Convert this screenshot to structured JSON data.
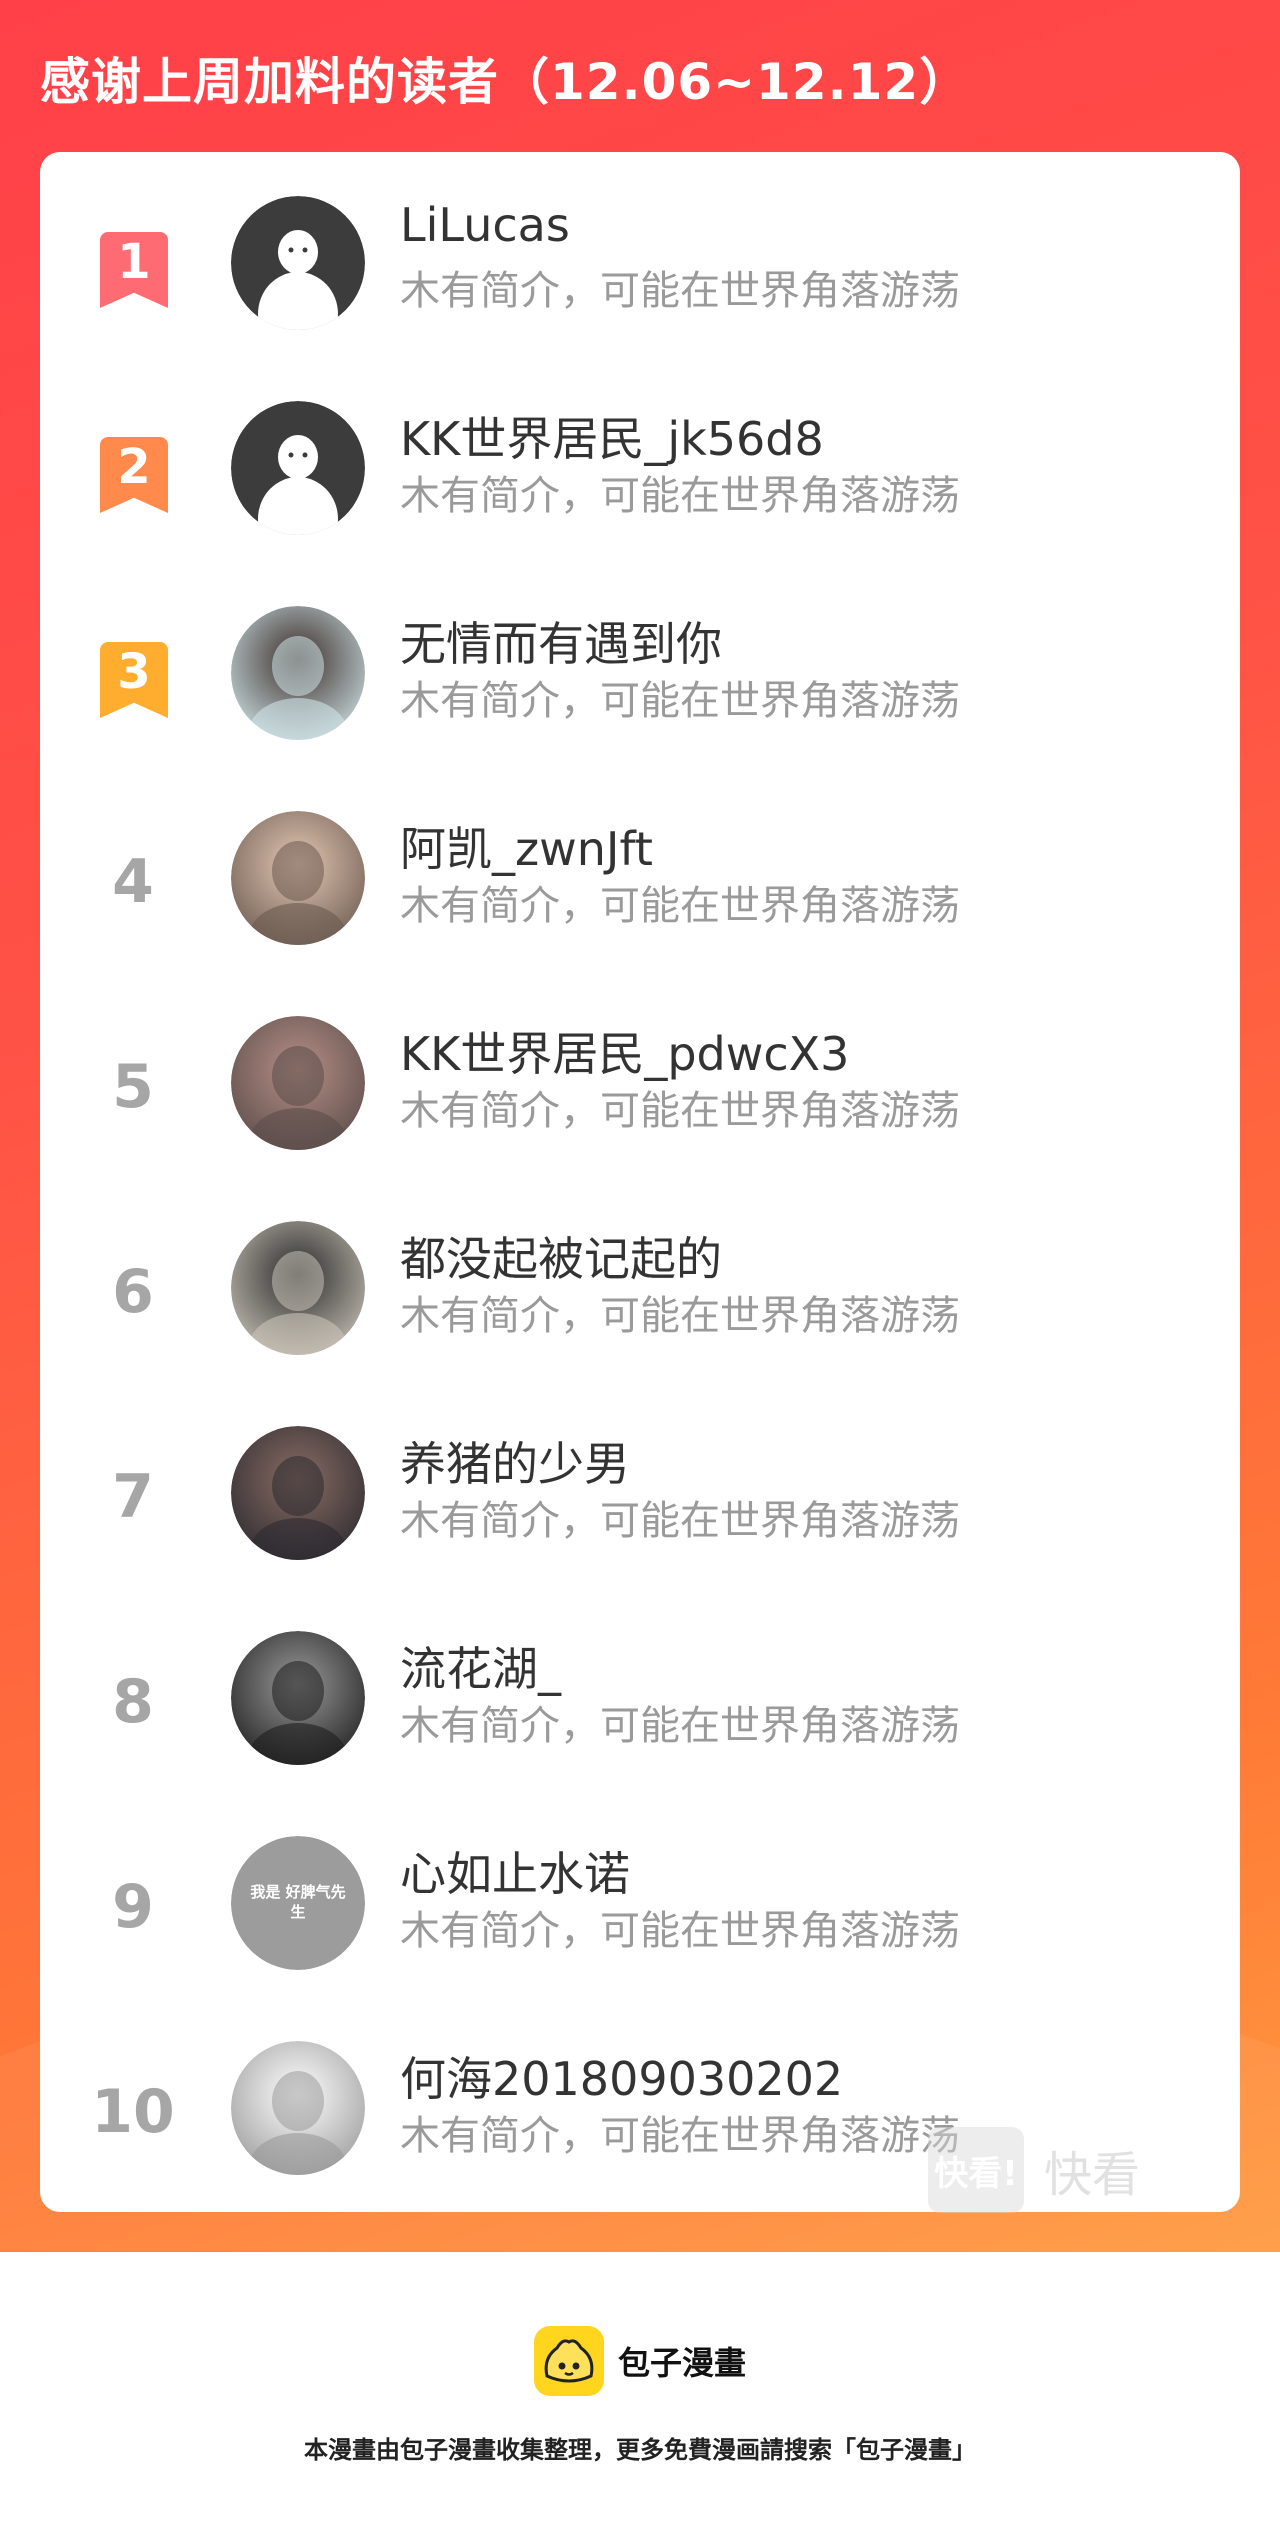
{
  "header": {
    "title": "感谢上周加料的读者（12.06~12.12）"
  },
  "readers": [
    {
      "rank": "1",
      "name": "LiLucas",
      "bio": "木有简介，可能在世界角落游荡",
      "badge_color": "#ff6b72",
      "avatar": "default-avatar"
    },
    {
      "rank": "2",
      "name": "KK世界居民_jk56d8",
      "bio": "木有简介，可能在世界角落游荡",
      "badge_color": "#ff8a4c",
      "avatar": "default-avatar"
    },
    {
      "rank": "3",
      "name": "无情而有遇到你",
      "bio": "木有简介，可能在世界角落游荡",
      "badge_color": "#ffad2e",
      "avatar": "photo-avatar"
    },
    {
      "rank": "4",
      "name": "阿凯_zwnJft",
      "bio": "木有简介，可能在世界角落游荡",
      "avatar": "photo-avatar"
    },
    {
      "rank": "5",
      "name": "KK世界居民_pdwcX3",
      "bio": "木有简介，可能在世界角落游荡",
      "avatar": "photo-avatar"
    },
    {
      "rank": "6",
      "name": "都没起被记起的",
      "bio": "木有简介，可能在世界角落游荡",
      "avatar": "photo-avatar"
    },
    {
      "rank": "7",
      "name": "养猪的少男",
      "bio": "木有简介，可能在世界角落游荡",
      "avatar": "photo-avatar"
    },
    {
      "rank": "8",
      "name": "流花湖_",
      "bio": "木有简介，可能在世界角落游荡",
      "avatar": "photo-avatar"
    },
    {
      "rank": "9",
      "name": "心如止水诺",
      "bio": "木有简介，可能在世界角落游荡",
      "avatar": "text-avatar",
      "avatar_text": "我是 好脾气先生"
    },
    {
      "rank": "10",
      "name": "何海201809030202",
      "bio": "木有简介，可能在世界角落游荡",
      "avatar": "photo-avatar"
    }
  ],
  "watermark": {
    "badge": "快看!",
    "text": "快看"
  },
  "footer": {
    "logo_text": "包子漫畫",
    "notice": "本漫畫由包子漫畫收集整理，更多免費漫画請搜索「包子漫畫」"
  },
  "colors": {
    "banner": "#ff4b46",
    "rank_gray": "#a6a6a6",
    "logo_yellow": "#ffd51e"
  }
}
